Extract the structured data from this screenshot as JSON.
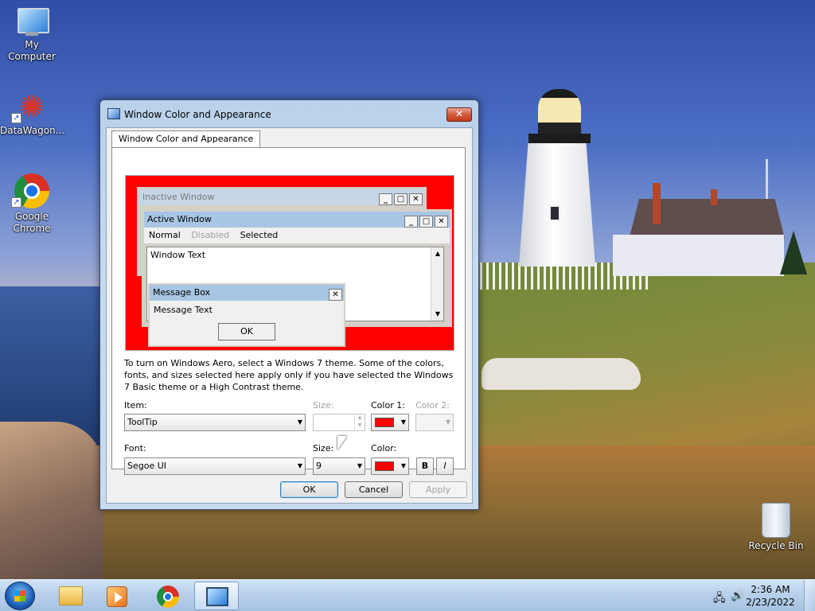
{
  "desktop": {
    "icons": [
      {
        "label": "My Computer",
        "icon": "computer-icon"
      },
      {
        "label": "DataWagon...",
        "icon": "datawagon-icon"
      },
      {
        "label": "Google Chrome",
        "icon": "chrome-icon"
      },
      {
        "label": "Recycle Bin",
        "icon": "recycle-bin-icon"
      }
    ]
  },
  "window": {
    "title": "Window Color and Appearance",
    "close_glyph": "✕",
    "tab_label": "Window Color and Appearance",
    "preview": {
      "inactive_title": "Inactive Window",
      "active_title": "Active Window",
      "menu": {
        "normal": "Normal",
        "disabled": "Disabled",
        "selected": "Selected"
      },
      "window_text": "Window Text",
      "message_box_title": "Message Box",
      "message_text": "Message Text",
      "ok": "OK",
      "min_glyph": "_",
      "max_glyph": "□",
      "close_glyph": "✕"
    },
    "info_text": "To turn on Windows Aero, select a Windows 7 theme.  Some of the colors, fonts, and sizes selected here apply only if you have selected the Windows 7 Basic theme or a High Contrast theme.",
    "item": {
      "label": "Item:",
      "value": "ToolTip"
    },
    "item_size": {
      "label": "Size:",
      "value": ""
    },
    "color1": {
      "label": "Color 1:",
      "value": "#ff0000"
    },
    "color2": {
      "label": "Color 2:",
      "value": ""
    },
    "font": {
      "label": "Font:",
      "value": "Segoe UI"
    },
    "font_size": {
      "label": "Size:",
      "value": "9"
    },
    "font_color": {
      "label": "Color:",
      "value": "#ff0000"
    },
    "bold_label": "B",
    "italic_label": "I",
    "buttons": {
      "ok": "OK",
      "cancel": "Cancel",
      "apply": "Apply"
    }
  },
  "taskbar": {
    "apps": [
      "windows-explorer-icon",
      "media-player-icon",
      "chrome-icon",
      "display-settings-icon"
    ],
    "time": "2:36 AM",
    "date": "2/23/2022"
  },
  "colors": {
    "accent_red": "#ff0000",
    "taskbar": "#b8d0ea"
  }
}
